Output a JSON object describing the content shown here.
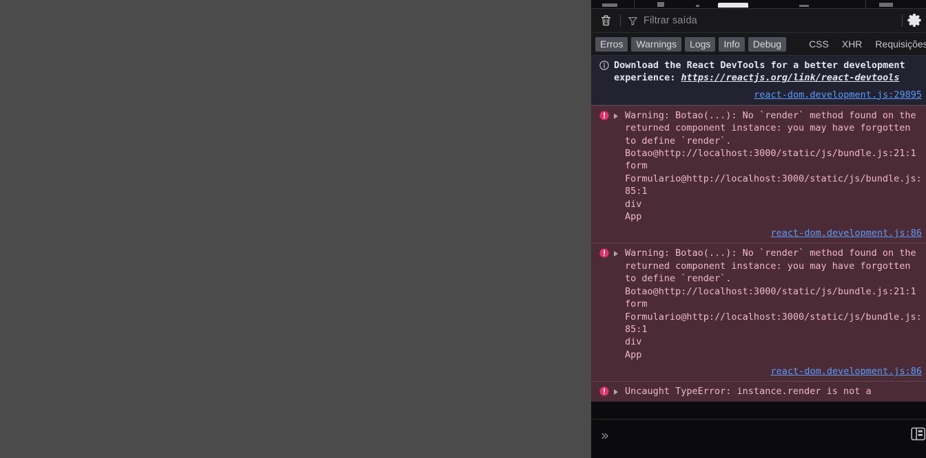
{
  "window": {
    "background_color": "#4b4b4b",
    "panel_background": "#0b0b0d"
  },
  "devtools": {
    "toolbar": {
      "clear_button_label": "Limpar",
      "clear_icon": "trash-icon",
      "filter_icon": "funnel-icon",
      "filter_placeholder": "Filtrar saída",
      "filter_value": "",
      "settings_icon": "gear-icon"
    },
    "filters": {
      "pills": [
        {
          "label": "Erros",
          "active": true
        },
        {
          "label": "Warnings",
          "active": true
        },
        {
          "label": "Logs",
          "active": true
        },
        {
          "label": "Info",
          "active": true
        },
        {
          "label": "Debug",
          "active": true
        }
      ],
      "categories": [
        {
          "label": "CSS",
          "active": false
        },
        {
          "label": "XHR",
          "active": false
        },
        {
          "label": "Requisições",
          "active": false
        }
      ]
    },
    "messages": [
      {
        "type": "info",
        "icon": "info-circle-icon",
        "text_before": "Download the React DevTools for a better development experience: ",
        "link": "https://reactjs.org/link/react-devtools",
        "source": "react-dom.development.js:29895"
      },
      {
        "type": "error",
        "icon": "error-circle-icon",
        "expander": "triangle-right-icon",
        "text": "Warning: Botao(...): No `render` method found on the returned component instance: you may have forgotten to define `render`.\nBotao@http://localhost:3000/static/js/bundle.js:21:1\nform\nFormulario@http://localhost:3000/static/js/bundle.js:85:1\ndiv\nApp",
        "source": "react-dom.development.js:86"
      },
      {
        "type": "error",
        "icon": "error-circle-icon",
        "expander": "triangle-right-icon",
        "text": "Warning: Botao(...): No `render` method found on the returned component instance: you may have forgotten to define `render`.\nBotao@http://localhost:3000/static/js/bundle.js:21:1\nform\nFormulario@http://localhost:3000/static/js/bundle.js:85:1\ndiv\nApp",
        "source": "react-dom.development.js:86"
      },
      {
        "type": "error",
        "icon": "error-circle-icon",
        "expander": "triangle-right-icon",
        "text": "Uncaught TypeError: instance.render is not a",
        "source": ""
      }
    ],
    "prompt": {
      "chevron": "»",
      "input_value": "",
      "editor_icon": "split-console-icon"
    }
  },
  "colors": {
    "error_bg": "#4b2b36",
    "error_text": "#f0b8c8",
    "error_icon": "#e0306e",
    "info_bg": "#222230",
    "link": "#5a9cf8",
    "pill_active_bg": "#50505a"
  }
}
